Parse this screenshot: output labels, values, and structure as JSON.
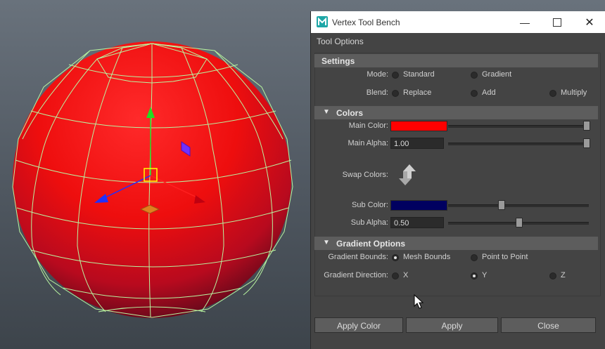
{
  "window": {
    "title": "Vertex Tool Bench",
    "icon": "maya-app-icon",
    "controls": [
      "minimize-icon",
      "maximize-icon",
      "close-icon"
    ]
  },
  "menubar": {
    "tool_options": "Tool Options"
  },
  "settings": {
    "header": "Settings",
    "mode_label": "Mode:",
    "mode_options": [
      "Standard",
      "Gradient"
    ],
    "mode_selected": "none",
    "blend_label": "Blend:",
    "blend_options": [
      "Replace",
      "Add",
      "Multiply"
    ],
    "blend_selected": "none"
  },
  "colors": {
    "header": "Colors",
    "main_color_label": "Main Color:",
    "main_color": "#ff0000",
    "main_color_slider": 1.0,
    "main_alpha_label": "Main Alpha:",
    "main_alpha": "1.00",
    "main_alpha_slider": 1.0,
    "swap_label": "Swap Colors:",
    "sub_color_label": "Sub Color:",
    "sub_color": "#000060",
    "sub_color_slider": 0.37,
    "sub_alpha_label": "Sub Alpha:",
    "sub_alpha": "0.50",
    "sub_alpha_slider": 0.5
  },
  "gradient_options": {
    "header": "Gradient Options",
    "bounds_label": "Gradient Bounds:",
    "bounds_options": [
      "Mesh Bounds",
      "Point to Point"
    ],
    "bounds_selected": "Mesh Bounds",
    "direction_label": "Gradient Direction:",
    "direction_options": [
      "X",
      "Y",
      "Z"
    ],
    "direction_selected": "Y"
  },
  "buttons": {
    "apply_color": "Apply Color",
    "apply": "Apply",
    "close": "Close"
  },
  "viewport": {
    "mesh_color": "#ff0000",
    "wire_color": "#b8ff9a"
  }
}
